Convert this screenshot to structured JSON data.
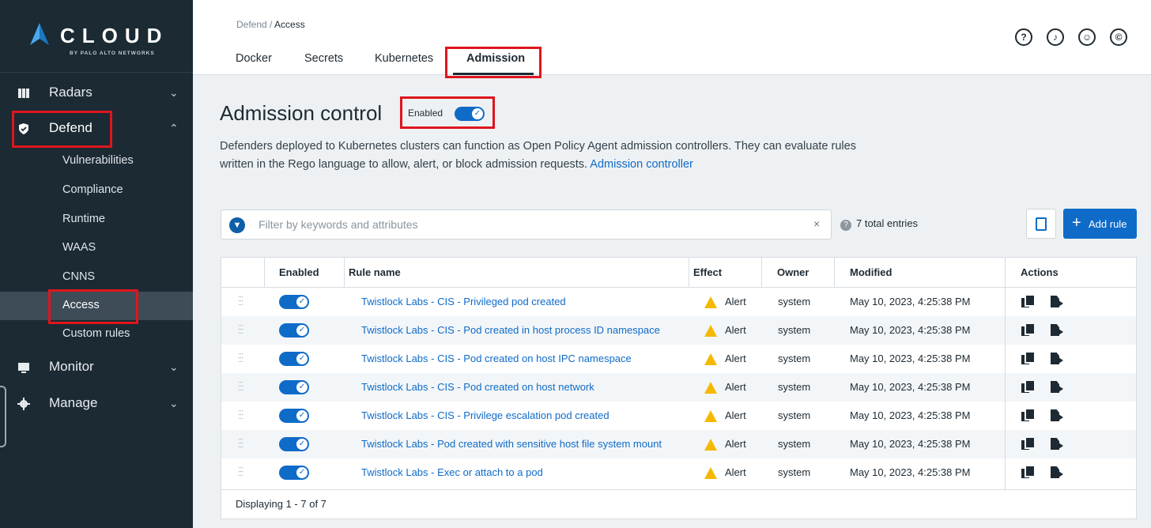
{
  "brand": {
    "name": "CLOUD",
    "sub": "BY PALO ALTO NETWORKS"
  },
  "sidebar": {
    "main": [
      {
        "label": "Radars",
        "chevron": "⌄"
      },
      {
        "label": "Defend",
        "chevron": "⌃"
      },
      {
        "label": "Monitor",
        "chevron": "⌄"
      },
      {
        "label": "Manage",
        "chevron": "⌄"
      }
    ],
    "sub": [
      "Vulnerabilities",
      "Compliance",
      "Runtime",
      "WAAS",
      "CNNS",
      "Access",
      "Custom rules"
    ]
  },
  "header": {
    "breadcrumb_parent": "Defend",
    "breadcrumb_sep": " / ",
    "breadcrumb_current": "Access",
    "tabs": [
      "Docker",
      "Secrets",
      "Kubernetes",
      "Admission"
    ],
    "icons": [
      "?",
      "♪",
      "☺",
      "©"
    ]
  },
  "main": {
    "title": "Admission control",
    "enabled_label": "Enabled",
    "desc_line1": "Defenders deployed to Kubernetes clusters can function as Open Policy Agent admission controllers. They can evaluate rules",
    "desc_line2": "written in the Rego language to allow, alert, or block admission requests.",
    "desc_link": "Admission controller",
    "filter_placeholder": "Filter by keywords and attributes",
    "clear": "×",
    "entries": "7 total entries",
    "add_rule": "Add rule"
  },
  "table": {
    "columns": [
      "Enabled",
      "Rule name",
      "Effect",
      "Owner",
      "Modified",
      "Actions"
    ],
    "rows": [
      {
        "name": "Twistlock Labs - CIS - Privileged pod created",
        "effect": "Alert",
        "owner": "system",
        "modified": "May 10, 2023, 4:25:38 PM",
        "enabled": true
      },
      {
        "name": "Twistlock Labs - CIS - Pod created in host process ID namespace",
        "effect": "Alert",
        "owner": "system",
        "modified": "May 10, 2023, 4:25:38 PM",
        "enabled": true
      },
      {
        "name": "Twistlock Labs - CIS - Pod created on host IPC namespace",
        "effect": "Alert",
        "owner": "system",
        "modified": "May 10, 2023, 4:25:38 PM",
        "enabled": true
      },
      {
        "name": "Twistlock Labs - CIS - Pod created on host network",
        "effect": "Alert",
        "owner": "system",
        "modified": "May 10, 2023, 4:25:38 PM",
        "enabled": true
      },
      {
        "name": "Twistlock Labs - CIS - Privilege escalation pod created",
        "effect": "Alert",
        "owner": "system",
        "modified": "May 10, 2023, 4:25:38 PM",
        "enabled": true
      },
      {
        "name": "Twistlock Labs - Pod created with sensitive host file system mount",
        "effect": "Alert",
        "owner": "system",
        "modified": "May 10, 2023, 4:25:38 PM",
        "enabled": true
      },
      {
        "name": "Twistlock Labs - Exec or attach to a pod",
        "effect": "Alert",
        "owner": "system",
        "modified": "May 10, 2023, 4:25:38 PM",
        "enabled": true
      }
    ],
    "footer": "Displaying 1 - 7 of 7"
  },
  "colors": {
    "accent": "#0f6bc8",
    "sidebar": "#1b2a33",
    "highlight": "#e0151d",
    "warn": "#f5b800"
  }
}
